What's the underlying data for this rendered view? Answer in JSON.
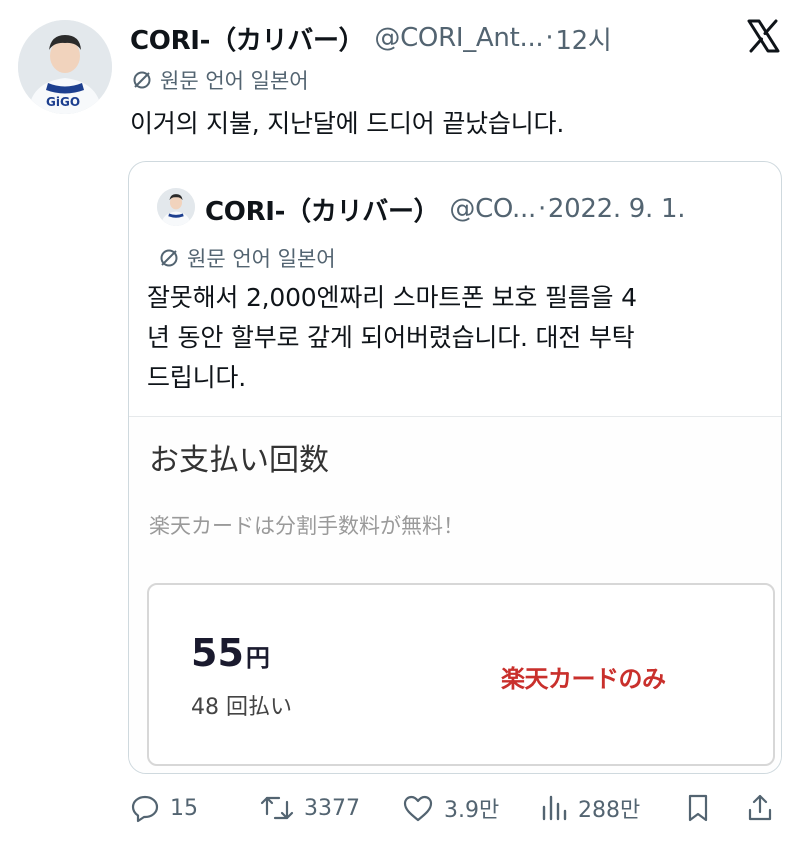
{
  "tweet": {
    "author": {
      "display_name": "CORI-（カリバー）",
      "handle": "@CORI_Ant...",
      "avatar_icon": "avatar-photo"
    },
    "separator": "·",
    "time": "12시",
    "translation_label": "원문 언어 일본어",
    "text": "이거의 지불, 지난달에 드디어 끝났습니다.",
    "platform_icon": "x-logo-icon"
  },
  "quote": {
    "author": {
      "display_name": "CORI-（カリバー）",
      "handle": "@CO...",
      "avatar_icon": "avatar-photo"
    },
    "separator": "·",
    "date": "2022. 9. 1.",
    "translation_label": "원문 언어 일본어",
    "text": "잘못해서 2,000엔짜리 스마트폰 보호 필름을 4년 동안 할부로 갚게 되어버렸습니다. 대전 부탁드립니다.",
    "text_lines": [
      "잘못해서 2,000엔짜리 스마트폰 보호 필름을 4",
      "년 동안 할부로 갚게 되어버렸습니다. 대전 부탁",
      "드립니다."
    ],
    "image": {
      "title": "お支払い回数",
      "note": "楽天カードは分割手数料が無料！",
      "price_value": "55",
      "price_unit": "円",
      "installments": "48 回払い",
      "badge": "楽天カードのみ"
    }
  },
  "actions": {
    "replies": "15",
    "retweets": "3377",
    "likes": "3.9만",
    "views": "288만"
  },
  "colors": {
    "text_primary": "#0f1419",
    "text_secondary": "#536471",
    "border": "#cfd9de",
    "badge_red": "#c9302c"
  }
}
